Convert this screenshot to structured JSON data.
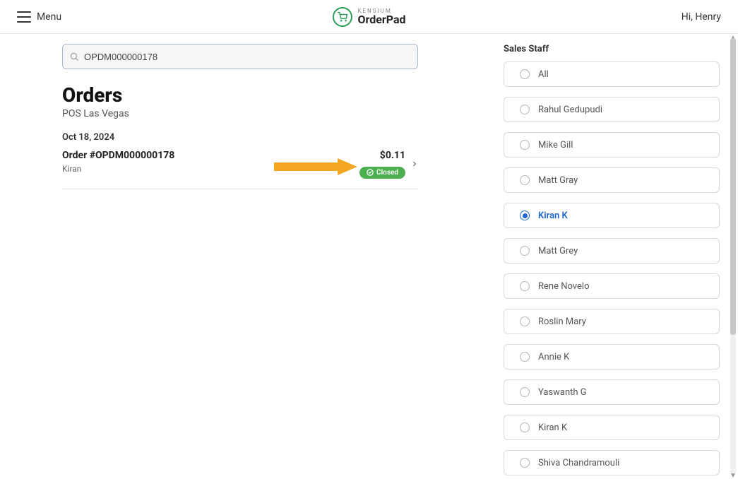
{
  "header": {
    "menu_label": "Menu",
    "brand_top": "KENSIUM",
    "brand_bottom": "OrderPad",
    "greeting": "Hi, Henry"
  },
  "search": {
    "value": "OPDM000000178"
  },
  "orders_section": {
    "title": "Orders",
    "location": "POS Las Vegas",
    "date": "Oct 18, 2024"
  },
  "order": {
    "id_label": "Order #OPDM000000178",
    "staff": "Kiran",
    "amount": "$0.11",
    "status": "Closed"
  },
  "side_panel": {
    "title": "Sales Staff",
    "selected_index": 4,
    "staff": [
      {
        "name": "All"
      },
      {
        "name": "Rahul Gedupudi"
      },
      {
        "name": "Mike Gill"
      },
      {
        "name": "Matt Gray"
      },
      {
        "name": "Kiran K"
      },
      {
        "name": "Matt Grey"
      },
      {
        "name": "Rene Novelo"
      },
      {
        "name": "Roslin Mary"
      },
      {
        "name": "Annie K"
      },
      {
        "name": "Yaswanth G"
      },
      {
        "name": "Kiran K"
      },
      {
        "name": "Shiva Chandramouli"
      }
    ]
  },
  "colors": {
    "accent_green": "#4caf50",
    "accent_blue": "#1e66d0",
    "arrow": "#f5a623"
  }
}
